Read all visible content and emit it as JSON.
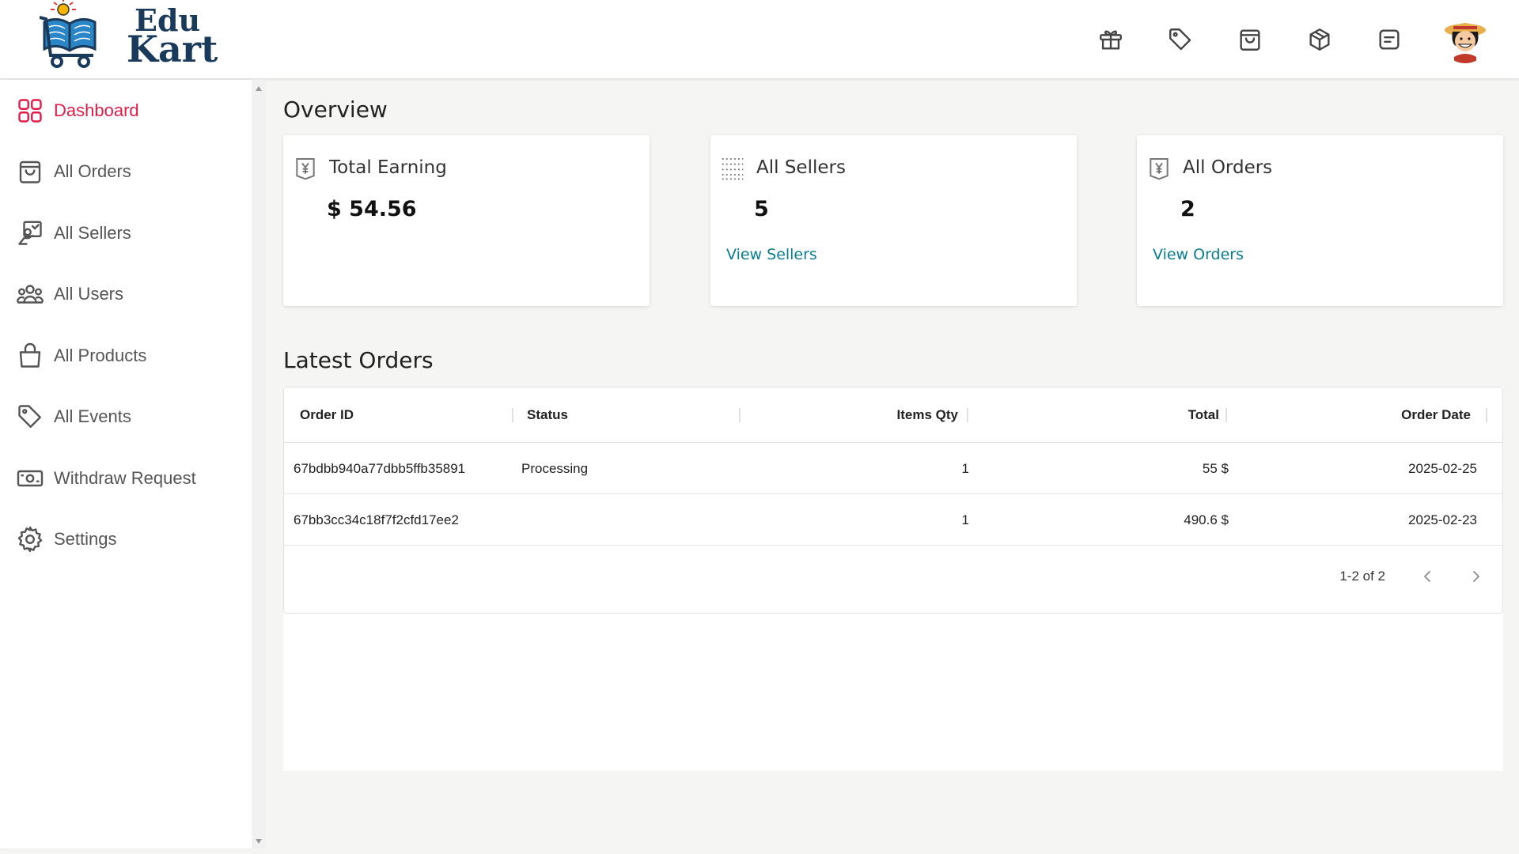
{
  "brand": {
    "line1": "Edu",
    "line2": "Kart"
  },
  "header": {
    "icons": [
      "gift-icon",
      "tag-icon",
      "shopping-bag-icon",
      "package-icon",
      "message-icon"
    ]
  },
  "sidebar": {
    "items": [
      {
        "label": "Dashboard",
        "icon": "grid-icon",
        "active": true
      },
      {
        "label": "All Orders",
        "icon": "shopping-bag-icon"
      },
      {
        "label": "All Sellers",
        "icon": "seller-icon"
      },
      {
        "label": "All Users",
        "icon": "users-icon"
      },
      {
        "label": "All Products",
        "icon": "bag-icon"
      },
      {
        "label": "All Events",
        "icon": "tag-icon"
      },
      {
        "label": "Withdraw Request",
        "icon": "cash-icon"
      },
      {
        "label": "Settings",
        "icon": "gear-icon"
      }
    ]
  },
  "overview": {
    "title": "Overview",
    "cards": [
      {
        "title": "Total Earning",
        "value": "$ 54.56",
        "link": ""
      },
      {
        "title": "All Sellers",
        "value": "5",
        "link": "View Sellers"
      },
      {
        "title": "All Orders",
        "value": "2",
        "link": "View Orders"
      }
    ]
  },
  "latest_orders": {
    "title": "Latest Orders",
    "columns": [
      "Order ID",
      "Status",
      "Items Qty",
      "Total",
      "Order Date"
    ],
    "rows": [
      {
        "id": "67bdbb940a77dbb5ffb35891",
        "status": "Processing",
        "qty": "1",
        "total": "55 $",
        "date": "2025-02-25"
      },
      {
        "id": "67bb3cc34c18f7f2cfd17ee2",
        "status": "",
        "qty": "1",
        "total": "490.6 $",
        "date": "2025-02-23"
      }
    ],
    "pagination": "1-2 of 2"
  },
  "colors": {
    "accent": "#e11d48",
    "link": "#077c93",
    "brand": "#1a3a5c"
  }
}
